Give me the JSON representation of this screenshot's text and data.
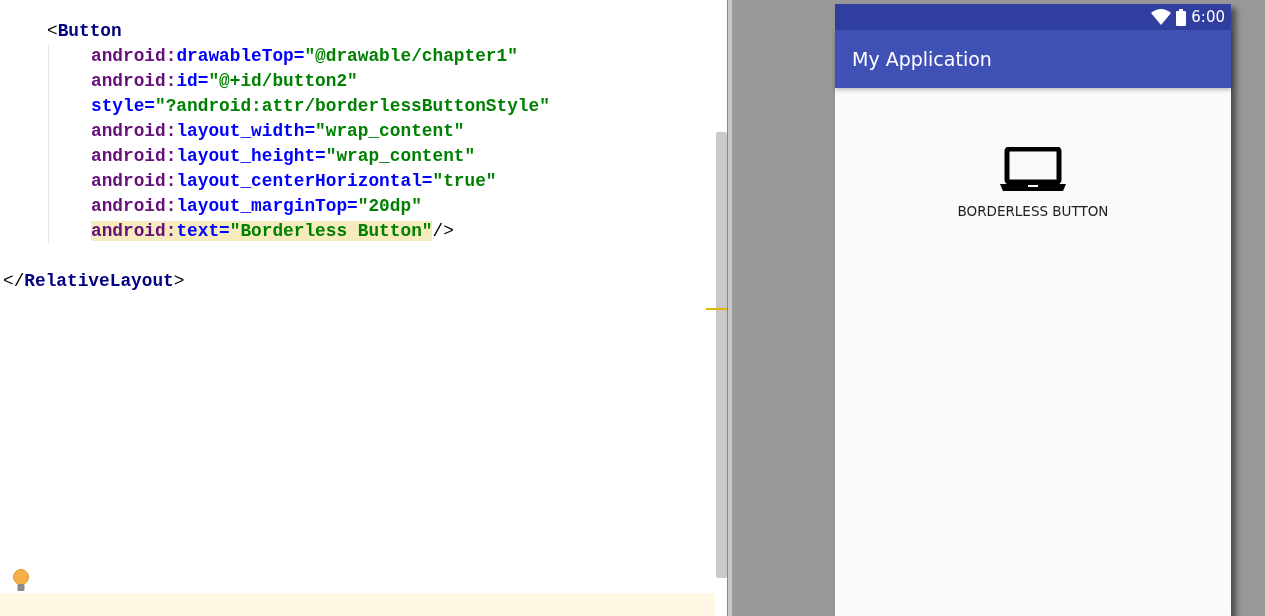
{
  "editor": {
    "code": [
      {
        "children": [
          {
            "tokens": [
              {
                "kind": "punct",
                "text": "<"
              },
              {
                "kind": "tag",
                "text": "Button"
              }
            ],
            "children": [
              {
                "highlighted": false,
                "tokens": [
                  {
                    "kind": "ns",
                    "text": "android:"
                  },
                  {
                    "kind": "attr",
                    "text": "drawableTop="
                  },
                  {
                    "kind": "value",
                    "text": "\"@drawable/chapter1\""
                  }
                ]
              },
              {
                "highlighted": false,
                "tokens": [
                  {
                    "kind": "ns",
                    "text": "android:"
                  },
                  {
                    "kind": "attr",
                    "text": "id="
                  },
                  {
                    "kind": "value",
                    "text": "\"@+id/button2\""
                  }
                ]
              },
              {
                "highlighted": false,
                "tokens": [
                  {
                    "kind": "attr",
                    "text": "style="
                  },
                  {
                    "kind": "value",
                    "text": "\"?android:attr/borderlessButtonStyle\""
                  }
                ]
              },
              {
                "highlighted": false,
                "tokens": [
                  {
                    "kind": "ns",
                    "text": "android:"
                  },
                  {
                    "kind": "attr",
                    "text": "layout_width="
                  },
                  {
                    "kind": "value",
                    "text": "\"wrap_content\""
                  }
                ]
              },
              {
                "highlighted": false,
                "tokens": [
                  {
                    "kind": "ns",
                    "text": "android:"
                  },
                  {
                    "kind": "attr",
                    "text": "layout_height="
                  },
                  {
                    "kind": "value",
                    "text": "\"wrap_content\""
                  }
                ]
              },
              {
                "highlighted": false,
                "tokens": [
                  {
                    "kind": "ns",
                    "text": "android:"
                  },
                  {
                    "kind": "attr",
                    "text": "layout_centerHorizontal="
                  },
                  {
                    "kind": "value",
                    "text": "\"true\""
                  }
                ]
              },
              {
                "highlighted": false,
                "tokens": [
                  {
                    "kind": "ns",
                    "text": "android:"
                  },
                  {
                    "kind": "attr",
                    "text": "layout_marginTop="
                  },
                  {
                    "kind": "value",
                    "text": "\"20dp\""
                  }
                ]
              },
              {
                "highlighted": true,
                "tokens": [
                  {
                    "kind": "ns",
                    "text": "android:"
                  },
                  {
                    "kind": "attr",
                    "text": "text="
                  },
                  {
                    "kind": "value",
                    "text": "\"Borderless Button\""
                  },
                  {
                    "kind": "close",
                    "text": "/>"
                  }
                ]
              }
            ]
          }
        ]
      },
      {
        "tokens": [
          {
            "kind": "punct",
            "text": "</"
          },
          {
            "kind": "tag",
            "text": "RelativeLayout"
          },
          {
            "kind": "punct",
            "text": ">"
          }
        ]
      }
    ]
  },
  "preview": {
    "status_bar": {
      "time": "6:00"
    },
    "app_bar": {
      "title": "My Application"
    },
    "button": {
      "label": "BORDERLESS BUTTON"
    }
  }
}
